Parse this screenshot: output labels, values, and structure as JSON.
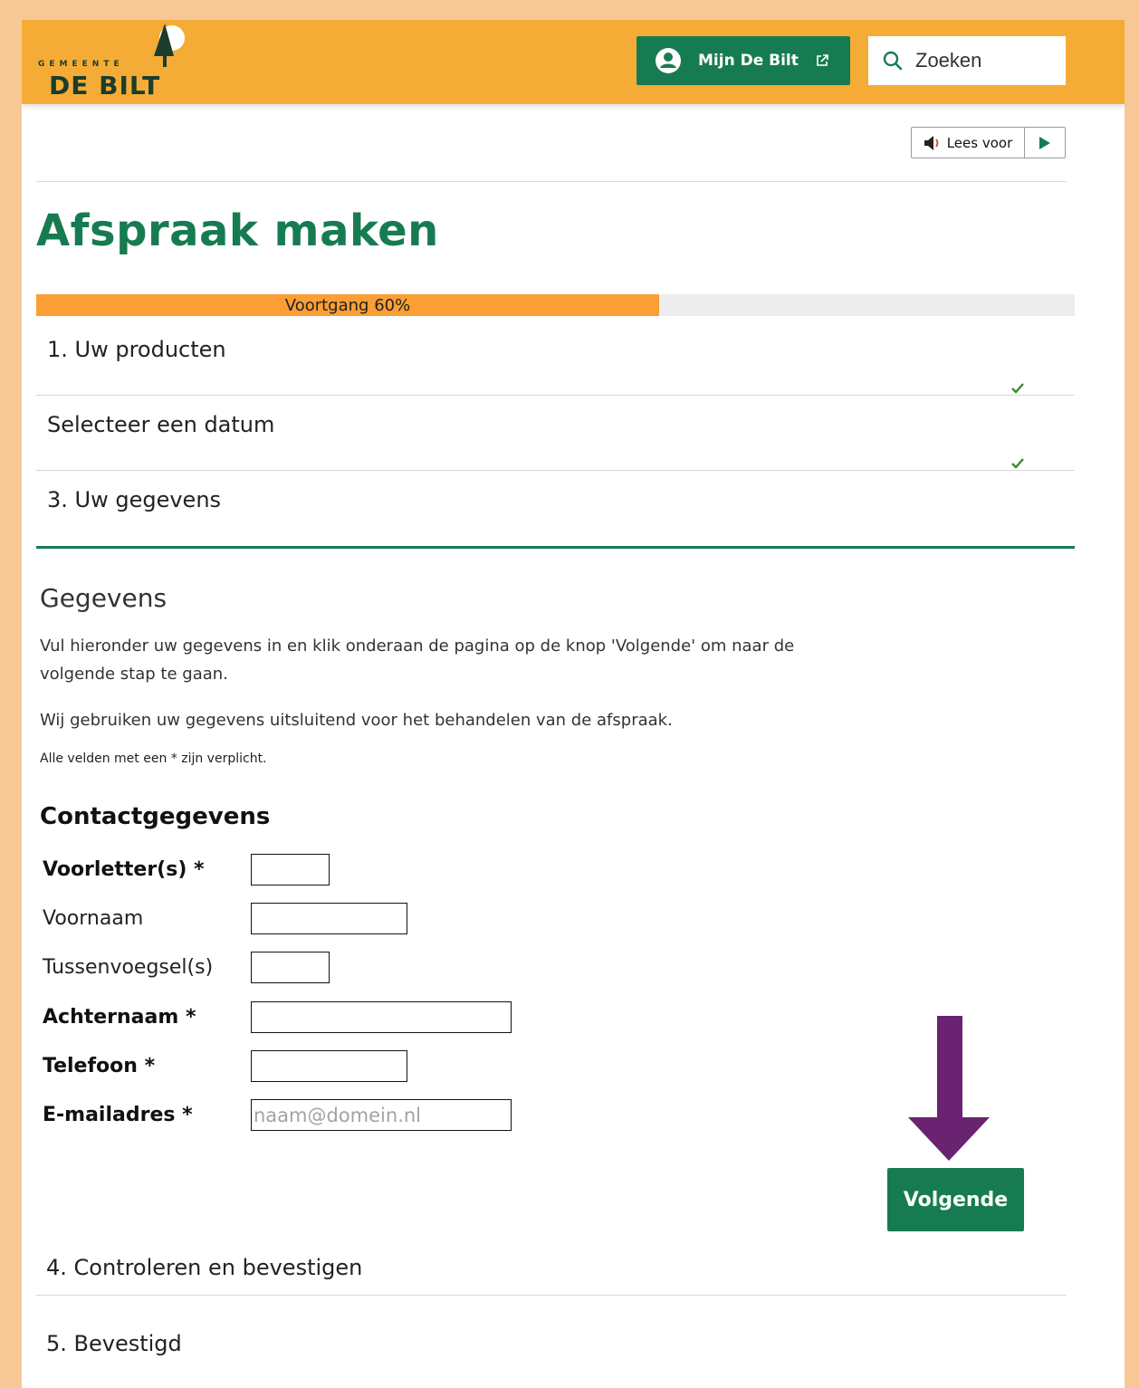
{
  "header": {
    "logo_top": "GEMEENTE",
    "logo_name": "DE BILT",
    "mijn_label": "Mijn De Bilt",
    "search_placeholder": "Zoeken"
  },
  "reader": {
    "label": "Lees voor"
  },
  "page": {
    "title": "Afspraak maken"
  },
  "progress": {
    "label": "Voortgang 60%",
    "value": 0.6
  },
  "steps": [
    {
      "label": "1. Uw producten",
      "completed": true
    },
    {
      "label": "Selecteer een datum",
      "completed": true
    },
    {
      "label": "3. Uw gegevens",
      "active": true
    },
    {
      "label": "4. Controleren en bevestigen"
    },
    {
      "label": "5. Bevestigd"
    }
  ],
  "content": {
    "heading": "Gegevens",
    "intro": "Vul hieronder uw gegevens in en klik onderaan de pagina op de knop 'Volgende' om naar de volgende stap te gaan.",
    "privacy": "Wij gebruiken uw gegevens uitsluitend voor het behandelen van de afspraak.",
    "required_note": "Alle velden met een * zijn verplicht.",
    "section_title": "Contactgegevens",
    "fields": [
      {
        "label": "Voorletter(s)  *",
        "required": true,
        "value": "",
        "placeholder": ""
      },
      {
        "label": "Voornaam",
        "required": false,
        "value": "",
        "placeholder": ""
      },
      {
        "label": "Tussenvoegsel(s)",
        "required": false,
        "value": "",
        "placeholder": ""
      },
      {
        "label": "Achternaam  *",
        "required": true,
        "value": "",
        "placeholder": ""
      },
      {
        "label": "Telefoon  *",
        "required": true,
        "value": "",
        "placeholder": ""
      },
      {
        "label": "E-mailadres  *",
        "required": true,
        "value": "",
        "placeholder": "naam@domein.nl"
      }
    ],
    "next_button": "Volgende"
  },
  "colors": {
    "header_bg": "#f5ac36",
    "brand_green": "#177b51",
    "progress_fill": "#fa9e35",
    "arrow_purple": "#6a2370",
    "frame_border": "#f7c896"
  },
  "icons": [
    "user-icon",
    "external-link-icon",
    "search-icon",
    "speaker-icon",
    "play-icon",
    "checkmark-icon",
    "down-arrow-icon"
  ]
}
